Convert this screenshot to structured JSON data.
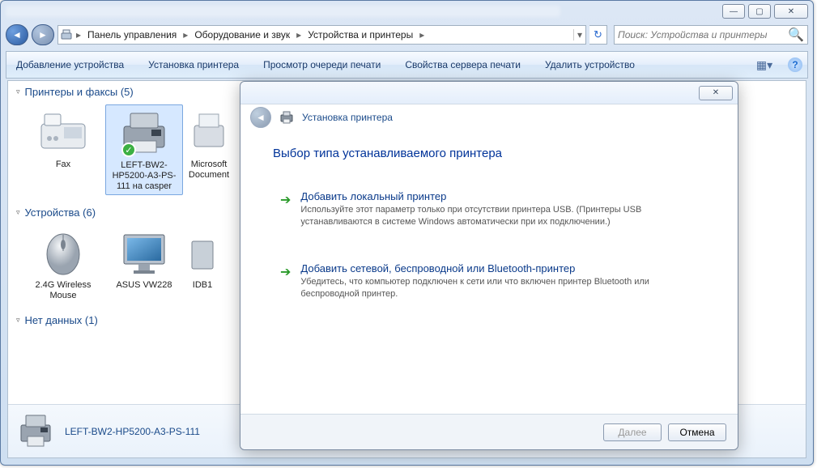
{
  "window_controls": {
    "min": "—",
    "max": "▢",
    "close": "✕"
  },
  "breadcrumb": {
    "seg1": "Панель управления",
    "seg2": "Оборудование и звук",
    "seg3": "Устройства и принтеры"
  },
  "search": {
    "placeholder": "Поиск: Устройства и принтеры"
  },
  "toolbar": {
    "add_device": "Добавление устройства",
    "add_printer": "Установка принтера",
    "view_queue": "Просмотр очереди печати",
    "server_props": "Свойства сервера печати",
    "remove_device": "Удалить устройство"
  },
  "groups": {
    "printers": {
      "title": "Принтеры и факсы (5)"
    },
    "devices": {
      "title": "Устройства (6)"
    },
    "nodata": {
      "title": "Нет данных (1)"
    }
  },
  "items": {
    "fax": "Fax",
    "printer1": "LEFT-BW2-HP5200-A3-PS-111 на casper",
    "printer2": "Microsoft Document",
    "mouse": "2.4G Wireless Mouse",
    "monitor": "ASUS VW228",
    "dev3": "IDB1"
  },
  "details": {
    "title": "LEFT-BW2-HP5200-A3-PS-111"
  },
  "dialog": {
    "header": "Установка принтера",
    "title": "Выбор типа устанавливаемого принтера",
    "opt1_title": "Добавить локальный принтер",
    "opt1_desc": "Используйте этот параметр только при отсутствии принтера USB. (Принтеры USB устанавливаются в системе Windows автоматически при их подключении.)",
    "opt2_title": "Добавить сетевой, беспроводной или Bluetooth-принтер",
    "opt2_desc": "Убедитесь, что компьютер подключен к сети или что включен принтер Bluetooth или беспроводной принтер.",
    "next": "Далее",
    "cancel": "Отмена"
  }
}
